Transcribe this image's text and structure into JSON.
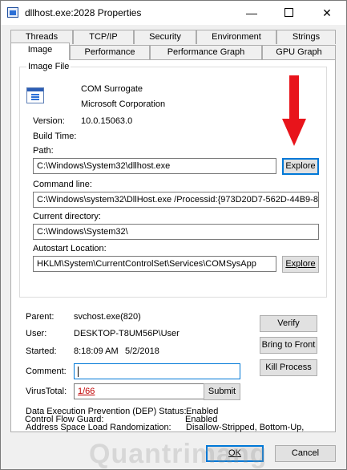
{
  "window": {
    "title": "dllhost.exe:2028 Properties",
    "minimize_glyph": "—",
    "close_glyph": "✕"
  },
  "tabs_top": [
    "Threads",
    "TCP/IP",
    "Security",
    "Environment",
    "Strings"
  ],
  "tabs_bottom": [
    "Image",
    "Performance",
    "Performance Graph",
    "GPU Graph"
  ],
  "active_tab": "Image",
  "image_file": {
    "group_label": "Image File",
    "description": "COM Surrogate",
    "company": "Microsoft Corporation",
    "version_label": "Version:",
    "version_value": "10.0.15063.0",
    "build_time_label": "Build Time:",
    "path_label": "Path:",
    "path_value": "C:\\Windows\\System32\\dllhost.exe",
    "explore_label": "Explore",
    "command_line_label": "Command line:",
    "command_line_value": "C:\\Windows\\system32\\DllHost.exe /Processid:{973D20D7-562D-44B9-8",
    "current_directory_label": "Current directory:",
    "current_directory_value": "C:\\Windows\\System32\\",
    "autostart_label": "Autostart Location:",
    "autostart_value": "HKLM\\System\\CurrentControlSet\\Services\\COMSysApp",
    "autostart_explore_label": "Explore"
  },
  "process": {
    "parent_label": "Parent:",
    "parent_value": "svchost.exe(820)",
    "user_label": "User:",
    "user_value": "DESKTOP-T8UM56P\\User",
    "started_label": "Started:",
    "started_time": "8:18:09 AM",
    "started_date": "5/2/2018",
    "comment_label": "Comment:",
    "comment_value": "",
    "virustotal_label": "VirusTotal:",
    "virustotal_value": "1/66",
    "submit_label": "Submit",
    "verify_label": "Verify",
    "bring_to_front_label": "Bring to Front",
    "kill_process_label": "Kill Process"
  },
  "security": {
    "dep_label": "Data Execution Prevention (DEP) Status:",
    "dep_value": "Enabled",
    "aslr_label": "Address Space Load Randomization:",
    "aslr_value": "Disallow-Stripped, Bottom-Up,",
    "cfg_label": "Control Flow Guard:",
    "cfg_value": "Enabled"
  },
  "footer": {
    "ok_label": "OK",
    "cancel_label": "Cancel"
  },
  "watermark": "Quantrimang",
  "colors": {
    "annotation_arrow": "#e8141b",
    "link": "#c00000",
    "focus": "#0078d7"
  }
}
